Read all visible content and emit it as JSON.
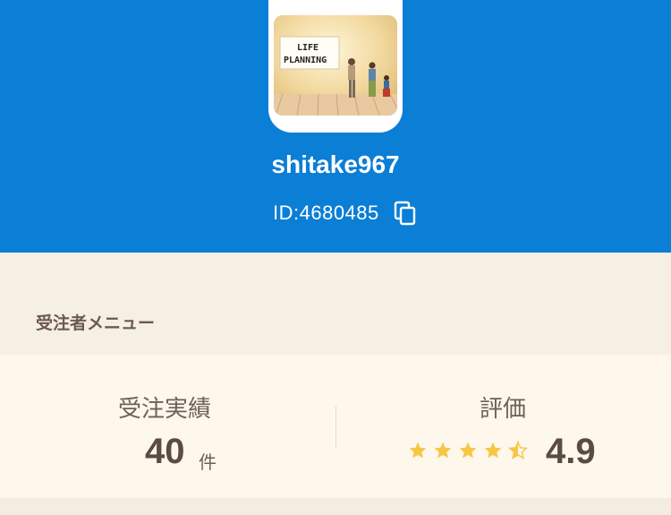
{
  "profile": {
    "username": "shitake967",
    "id_label": "ID:4680485",
    "avatar_text_line1": "LIFE",
    "avatar_text_line2": "PLANNING"
  },
  "menu": {
    "section_title": "受注者メニュー"
  },
  "stats": {
    "orders_label": "受注実績",
    "orders_count": "40",
    "orders_unit": "件",
    "rating_label": "評価",
    "rating_value": "4.9",
    "rating_stars_filled": 4.5,
    "rating_stars_total": 5
  },
  "colors": {
    "header_blue": "#0b7ed6",
    "star_yellow": "#f7c644",
    "text_brown": "#5c4b42"
  },
  "icons": {
    "copy": "copy-icon",
    "star": "star-icon"
  }
}
